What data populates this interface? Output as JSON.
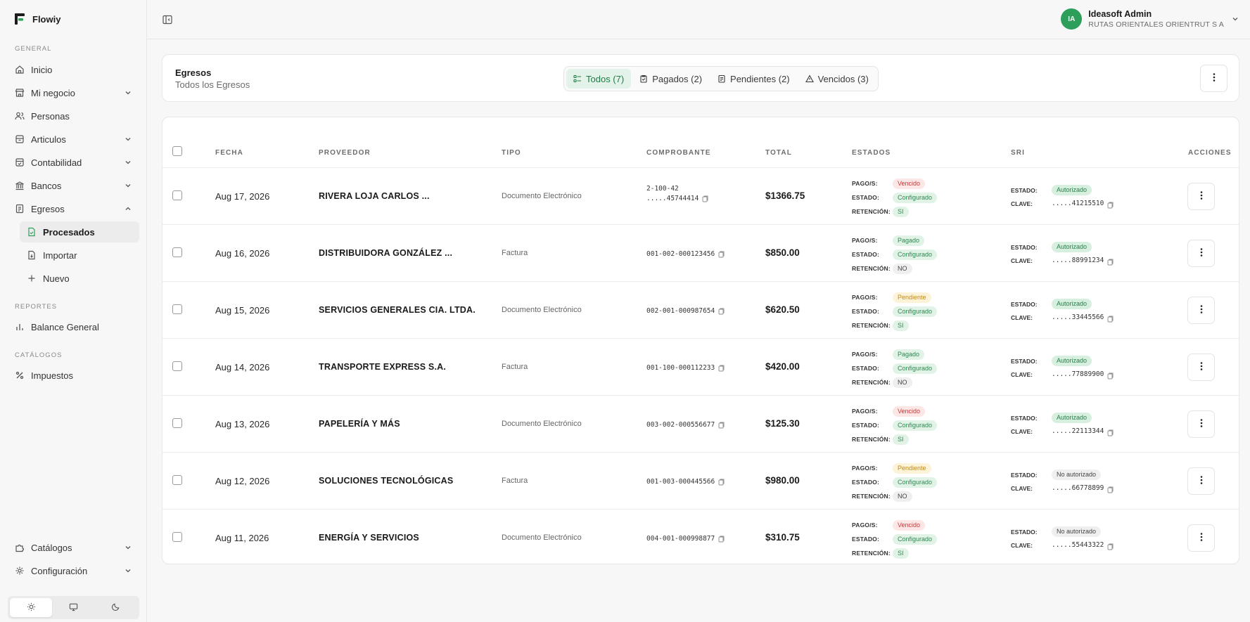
{
  "brand": {
    "name": "Flowiy",
    "accent": "#2e9e5b"
  },
  "sidebar": {
    "sections": {
      "general": "GENERAL",
      "reportes": "REPORTES",
      "catalogos": "CATÁLOGOS"
    },
    "items": [
      {
        "label": "Inicio",
        "icon": "home-icon"
      },
      {
        "label": "Mi negocio",
        "icon": "store-icon"
      },
      {
        "label": "Personas",
        "icon": "users-icon"
      },
      {
        "label": "Articulos",
        "icon": "box-icon"
      },
      {
        "label": "Contabilidad",
        "icon": "ledger-icon"
      },
      {
        "label": "Bancos",
        "icon": "bank-icon"
      },
      {
        "label": "Egresos",
        "icon": "receipt-icon"
      }
    ],
    "egresos_sub": [
      {
        "label": "Procesados",
        "icon": "file-check-icon"
      },
      {
        "label": "Importar",
        "icon": "file-import-icon"
      },
      {
        "label": "Nuevo",
        "icon": "plus-icon"
      }
    ],
    "reportes": [
      {
        "label": "Balance General",
        "icon": "bar-chart-icon"
      }
    ],
    "catalogos": [
      {
        "label": "Impuestos",
        "icon": "percent-icon"
      }
    ],
    "bottom": [
      {
        "label": "Catálogos",
        "icon": "puzzle-icon"
      },
      {
        "label": "Configuración",
        "icon": "gear-icon"
      }
    ],
    "theme": {
      "selected": "light"
    }
  },
  "user": {
    "initials": "IA",
    "name": "Ideasoft Admin",
    "org": "RUTAS ORIENTALES ORIENTRUT S A"
  },
  "header": {
    "title": "Egresos",
    "subtitle": "Todos los Egresos",
    "filters": [
      {
        "label": "Todos (7)",
        "active": true
      },
      {
        "label": "Pagados (2)",
        "active": false
      },
      {
        "label": "Pendientes (2)",
        "active": false
      },
      {
        "label": "Vencidos (3)",
        "active": false
      }
    ]
  },
  "table": {
    "columns": [
      "FECHA",
      "PROVEEDOR",
      "TIPO",
      "COMPROBANTE",
      "TOTAL",
      "ESTADOS",
      "SRI",
      "ACCIONES"
    ],
    "labels": {
      "pago": "PAGO/S:",
      "estado": "ESTADO:",
      "retencion": "RETENCIÓN:",
      "sri_estado": "ESTADO:",
      "sri_clave": "CLAVE:"
    },
    "rows": [
      {
        "fecha": "Aug 17, 2026",
        "proveedor": "RIVERA LOJA CARLOS ...",
        "tipo": "Documento Electrónico",
        "comprobante_top": "2-100-42",
        "comprobante": ".....45744414",
        "total": "$1366.75",
        "pago": "Vencido",
        "estado": "Configurado",
        "retencion": "SI",
        "sri_estado": "Autorizado",
        "clave": ".....41215510"
      },
      {
        "fecha": "Aug 16, 2026",
        "proveedor": "DISTRIBUIDORA GONZÁLEZ ...",
        "tipo": "Factura",
        "comprobante_top": "",
        "comprobante": "001-002-000123456",
        "total": "$850.00",
        "pago": "Pagado",
        "estado": "Configurado",
        "retencion": "NO",
        "sri_estado": "Autorizado",
        "clave": ".....88991234"
      },
      {
        "fecha": "Aug 15, 2026",
        "proveedor": "SERVICIOS GENERALES CIA. LTDA.",
        "tipo": "Documento Electrónico",
        "comprobante_top": "",
        "comprobante": "002-001-000987654",
        "total": "$620.50",
        "pago": "Pendiente",
        "estado": "Configurado",
        "retencion": "SI",
        "sri_estado": "Autorizado",
        "clave": ".....33445566"
      },
      {
        "fecha": "Aug 14, 2026",
        "proveedor": "TRANSPORTE EXPRESS S.A.",
        "tipo": "Factura",
        "comprobante_top": "",
        "comprobante": "001-100-000112233",
        "total": "$420.00",
        "pago": "Pagado",
        "estado": "Configurado",
        "retencion": "NO",
        "sri_estado": "Autorizado",
        "clave": ".....77889900"
      },
      {
        "fecha": "Aug 13, 2026",
        "proveedor": "PAPELERÍA Y MÁS",
        "tipo": "Documento Electrónico",
        "comprobante_top": "",
        "comprobante": "003-002-000556677",
        "total": "$125.30",
        "pago": "Vencido",
        "estado": "Configurado",
        "retencion": "SI",
        "sri_estado": "Autorizado",
        "clave": ".....22113344"
      },
      {
        "fecha": "Aug 12, 2026",
        "proveedor": "SOLUCIONES TECNOLÓGICAS",
        "tipo": "Factura",
        "comprobante_top": "",
        "comprobante": "001-003-000445566",
        "total": "$980.00",
        "pago": "Pendiente",
        "estado": "Configurado",
        "retencion": "NO",
        "sri_estado": "No autorizado",
        "clave": ".....66778899"
      },
      {
        "fecha": "Aug 11, 2026",
        "proveedor": "ENERGÍA Y SERVICIOS",
        "tipo": "Documento Electrónico",
        "comprobante_top": "",
        "comprobante": "004-001-000998877",
        "total": "$310.75",
        "pago": "Vencido",
        "estado": "Configurado",
        "retencion": "SI",
        "sri_estado": "No autorizado",
        "clave": ".....55443322"
      }
    ]
  }
}
